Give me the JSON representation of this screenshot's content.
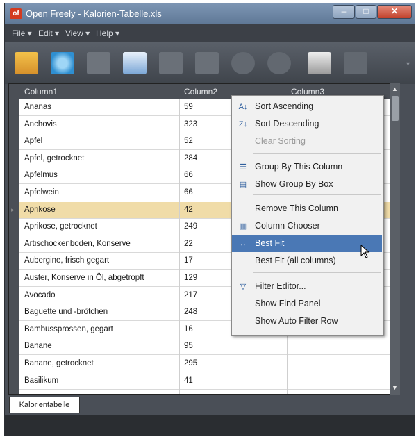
{
  "window": {
    "title": "Open Freely - Kalorien-Tabelle.xls",
    "app_icon": "of"
  },
  "menubar": [
    "File ▾",
    "Edit ▾",
    "View ▾",
    "Help ▾"
  ],
  "toolbar": {
    "icons": [
      "open-icon",
      "refresh-icon",
      "save-icon",
      "edit-icon",
      "copy-icon",
      "paste-icon",
      "find-icon",
      "find-next-icon",
      "print-icon",
      "settings-icon"
    ]
  },
  "grid": {
    "columns": [
      "Column1",
      "Column2",
      "Column3"
    ],
    "rows": [
      [
        "Ananas",
        "59"
      ],
      [
        "Anchovis",
        "323"
      ],
      [
        "Apfel",
        "52"
      ],
      [
        "Apfel, getrocknet",
        "284"
      ],
      [
        "Apfelmus",
        "66"
      ],
      [
        "Apfelwein",
        "66"
      ],
      [
        "Aprikose",
        "42"
      ],
      [
        "Aprikose, getrocknet",
        "249"
      ],
      [
        "Artischockenboden, Konserve",
        "22"
      ],
      [
        "Aubergine, frisch gegart",
        "17"
      ],
      [
        "Auster, Konserve in Öl, abgetropft",
        "129"
      ],
      [
        "Avocado",
        "217"
      ],
      [
        "Baguette und -brötchen",
        "248"
      ],
      [
        "Bambussprossen, gegart",
        "16"
      ],
      [
        "Banane",
        "95"
      ],
      [
        "Banane, getrocknet",
        "295"
      ],
      [
        "Basilikum",
        "41"
      ]
    ],
    "selected_row": 6
  },
  "sheet_tab": "Kalorientabelle",
  "context_menu": {
    "items": [
      {
        "label": "Sort Ascending",
        "icon": "sort-ascending-icon",
        "glyph": "A↓"
      },
      {
        "label": "Sort Descending",
        "icon": "sort-descending-icon",
        "glyph": "Z↓"
      },
      {
        "label": "Clear Sorting",
        "icon": "",
        "glyph": "",
        "disabled": true
      },
      {
        "label": "Group By This Column",
        "icon": "group-by-icon",
        "glyph": "☰"
      },
      {
        "label": "Show Group By Box",
        "icon": "group-box-icon",
        "glyph": "▤"
      },
      {
        "label": "Remove This Column",
        "icon": "",
        "glyph": ""
      },
      {
        "label": "Column Chooser",
        "icon": "column-chooser-icon",
        "glyph": "▥"
      },
      {
        "label": "Best Fit",
        "icon": "best-fit-icon",
        "glyph": "↔",
        "highlighted": true
      },
      {
        "label": "Best Fit (all columns)",
        "icon": "",
        "glyph": ""
      },
      {
        "label": "Filter Editor...",
        "icon": "filter-icon",
        "glyph": "▽"
      },
      {
        "label": "Show Find Panel",
        "icon": "",
        "glyph": ""
      },
      {
        "label": "Show Auto Filter Row",
        "icon": "",
        "glyph": ""
      }
    ]
  },
  "colors": {
    "selection": "#f0dca8",
    "menu_highlight": "#4a78b5",
    "header_bg": "#4b4f56"
  }
}
